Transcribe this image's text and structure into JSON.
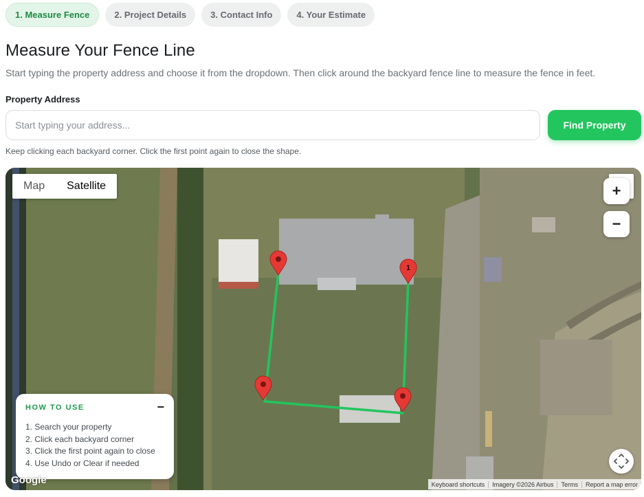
{
  "steps": [
    {
      "label": "1. Measure Fence",
      "active": true
    },
    {
      "label": "2. Project Details",
      "active": false
    },
    {
      "label": "3. Contact Info",
      "active": false
    },
    {
      "label": "4. Your Estimate",
      "active": false
    }
  ],
  "header": {
    "title": "Measure Your Fence Line",
    "subtitle": "Start typing the property address and choose it from the dropdown. Then click around the backyard fence line to measure the fence in feet."
  },
  "address": {
    "label": "Property Address",
    "placeholder": "Start typing your address...",
    "value": "",
    "button_label": "Find Property",
    "hint": "Keep clicking each backyard corner. Click the first point again to close the shape."
  },
  "map": {
    "type_options": [
      "Map",
      "Satellite"
    ],
    "selected_type": "Satellite",
    "zoom_in_label": "+",
    "zoom_out_label": "−",
    "first_marker_label": "1",
    "fence_color": "#22c55e",
    "marker_color": "#e53935",
    "google_label": "Google",
    "attribution": [
      "Keyboard shortcuts",
      "Imagery ©2026 Airbus",
      "Terms",
      "Report a map error"
    ]
  },
  "howto": {
    "title": "HOW TO USE",
    "minimize_label": "−",
    "items": [
      "1. Search your property",
      "2. Click each backyard corner",
      "3. Click the first point again to close",
      "4. Use Undo or Clear if needed"
    ]
  },
  "colors": {
    "accent": "#22c55e",
    "step_active_text": "#1f8a45",
    "step_active_bg": "#e3f5e8"
  }
}
